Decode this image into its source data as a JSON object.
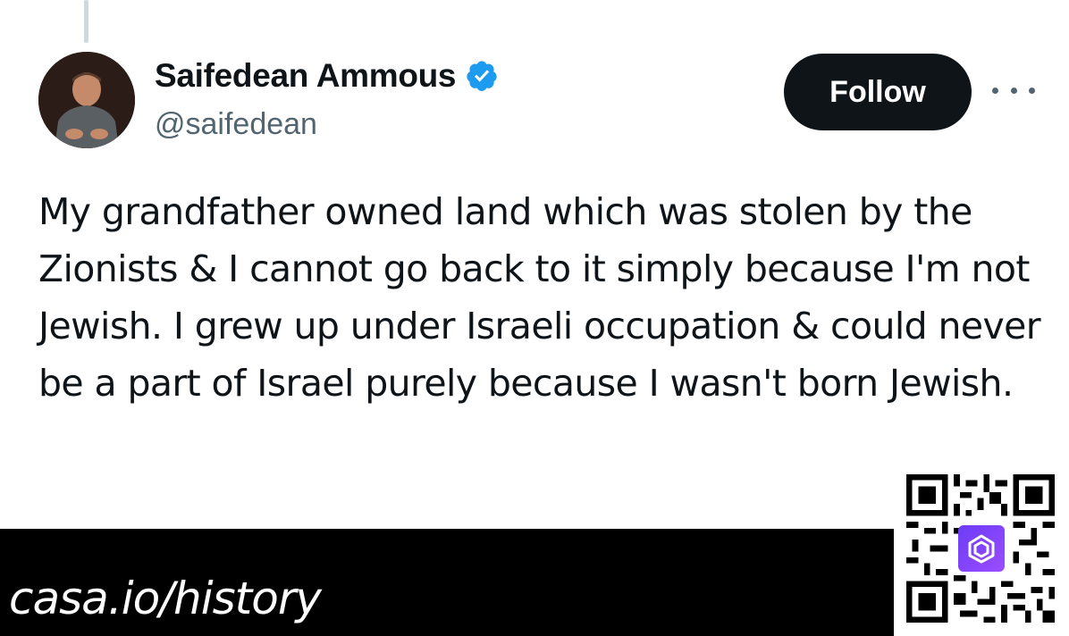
{
  "tweet": {
    "author": {
      "display_name": "Saifedean Ammous",
      "handle": "@saifedean",
      "verified_icon": "verified-badge-icon",
      "avatar": "profile-photo"
    },
    "follow_label": "Follow",
    "more_icon": "more-options-icon",
    "text": "My grandfather owned land which was stolen by the Zionists & I cannot go back to it simply because I'm not Jewish. I grew up under Israeli occupation & could never be a part of Israel purely because I wasn't born Jewish."
  },
  "overlay": {
    "url_text": "casa.io/history",
    "qr_icon": "qr-code-icon",
    "logo_icon": "casa-logo-icon"
  },
  "colors": {
    "follow_bg": "#0f1419",
    "verified_blue": "#1d9bf0",
    "handle_gray": "#536471",
    "bar_black": "#000000",
    "logo_purple": "#7b3ff2"
  }
}
